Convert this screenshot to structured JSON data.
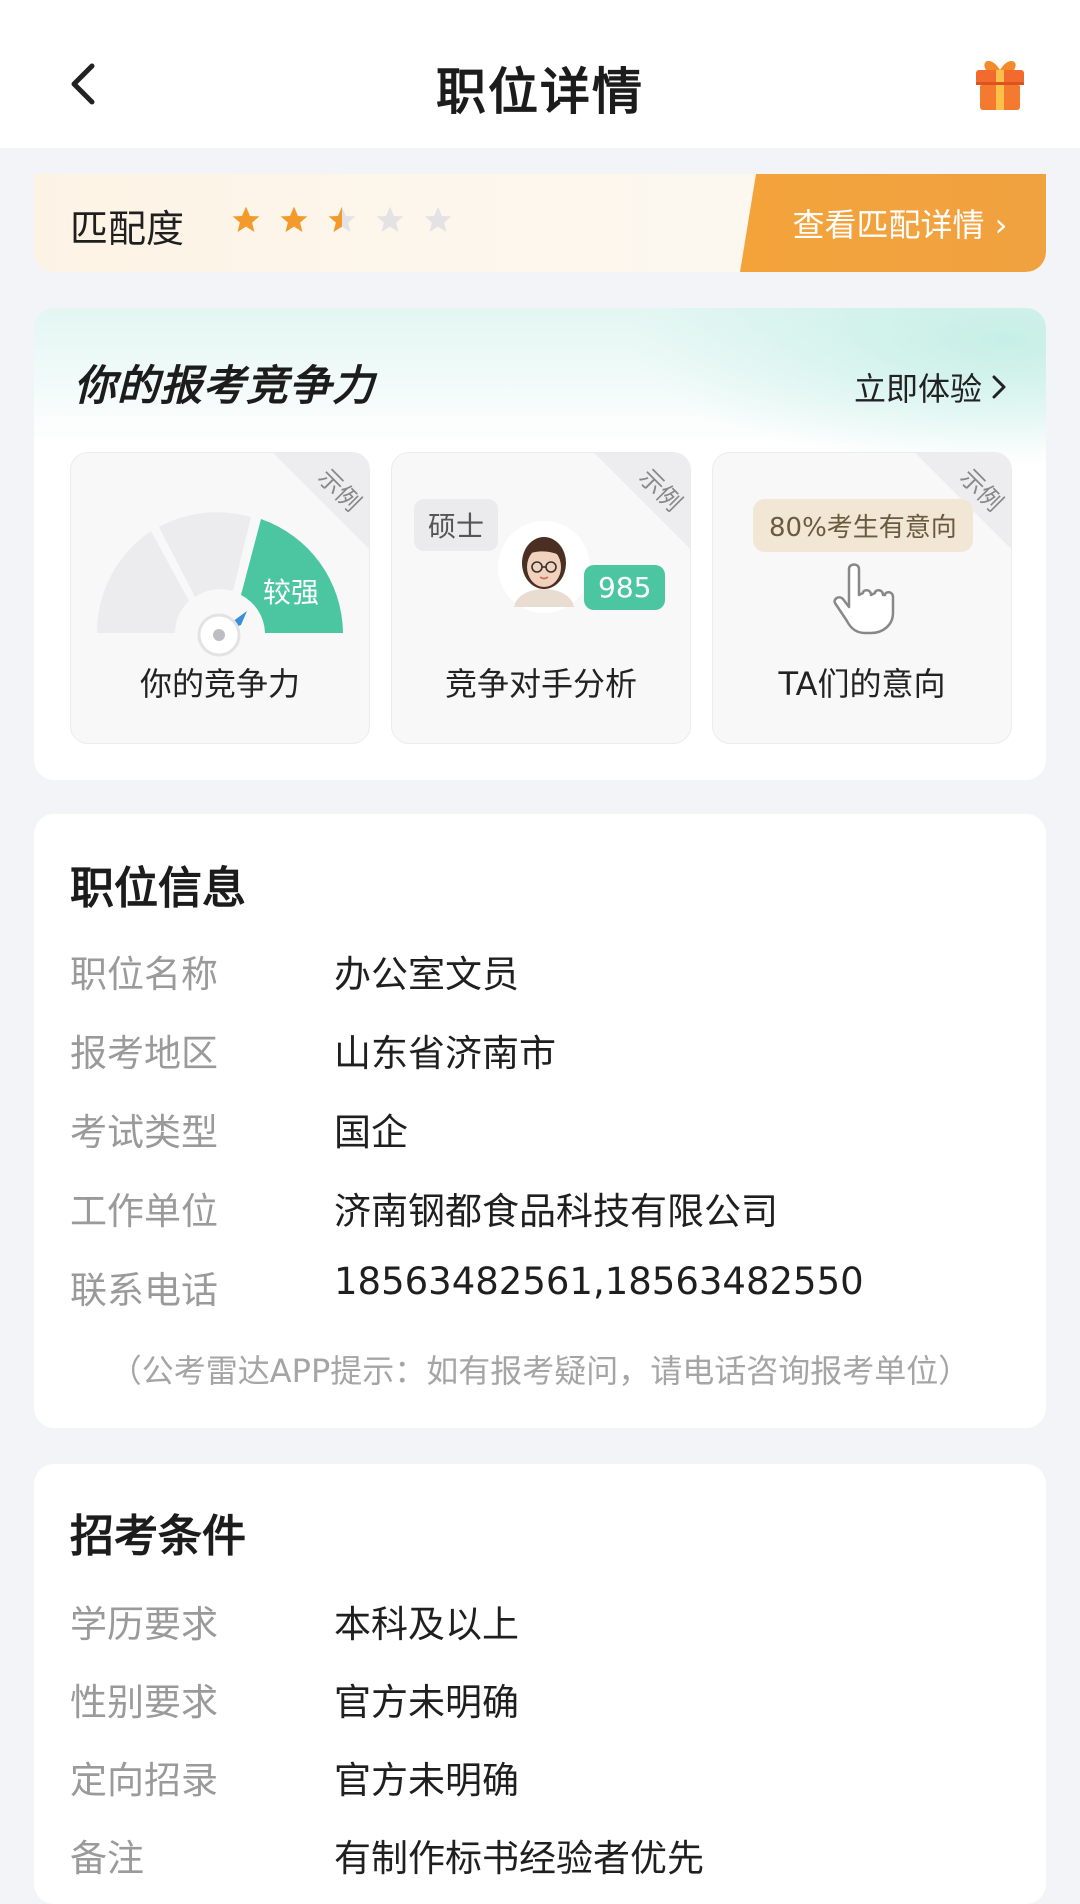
{
  "header": {
    "title": "职位详情",
    "back_icon": "chevron-left-icon",
    "gift_icon": "gift-icon"
  },
  "match": {
    "label": "匹配度",
    "rating": 2.5,
    "max_rating": 5,
    "detail_label": "查看匹配详情 ›",
    "accent_color": "#f4a33b"
  },
  "competitiveness": {
    "title": "你的报考竞争力",
    "try_label": "立即体验",
    "cards": [
      {
        "label": "你的竞争力",
        "badge": "示例",
        "level": "较强"
      },
      {
        "label": "竞争对手分析",
        "badge": "示例",
        "degree": "硕士",
        "school": "985"
      },
      {
        "label": "TA们的意向",
        "badge": "示例",
        "intent": "80%考生有意向"
      }
    ]
  },
  "position_info": {
    "title": "职位信息",
    "rows": [
      {
        "key": "职位名称",
        "value": "办公室文员"
      },
      {
        "key": "报考地区",
        "value": "山东省济南市"
      },
      {
        "key": "考试类型",
        "value": "国企"
      },
      {
        "key": "工作单位",
        "value": "济南钢都食品科技有限公司"
      },
      {
        "key": "联系电话",
        "value": "18563482561,18563482550"
      }
    ],
    "tip": "（公考雷达APP提示：如有报考疑问，请电话咨询报考单位）"
  },
  "requirements": {
    "title": "招考条件",
    "rows": [
      {
        "key": "学历要求",
        "value": "本科及以上"
      },
      {
        "key": "性别要求",
        "value": "官方未明确"
      },
      {
        "key": "定向招录",
        "value": "官方未明确"
      },
      {
        "key": "备注",
        "value": "有制作标书经验者优先"
      }
    ]
  }
}
